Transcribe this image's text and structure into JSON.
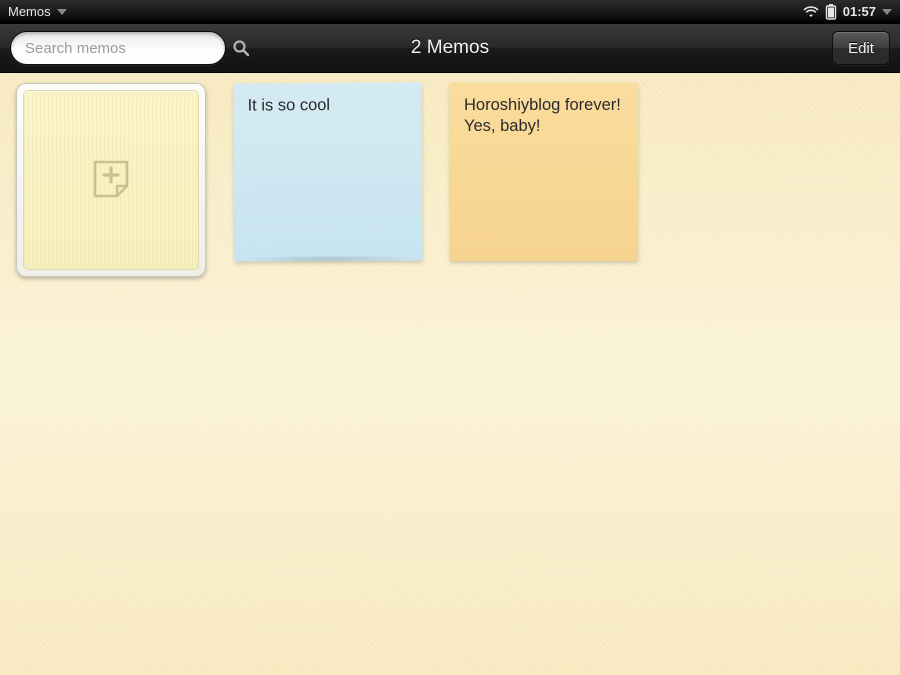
{
  "status": {
    "app_name": "Memos",
    "time": "01:57"
  },
  "header": {
    "search_placeholder": "Search memos",
    "title": "2 Memos",
    "edit_label": "Edit"
  },
  "memos": [
    {
      "text": "It is so cool",
      "color": "blue"
    },
    {
      "text": "Horoshiyblog forever! Yes, baby!",
      "color": "orange"
    }
  ]
}
